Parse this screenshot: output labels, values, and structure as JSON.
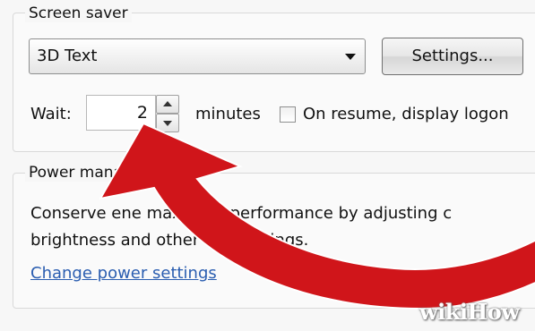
{
  "screen_saver": {
    "legend": "Screen saver",
    "selected_saver": "3D Text",
    "settings_button": "Settings...",
    "wait_label": "Wait:",
    "wait_value": "2",
    "minutes_label": "minutes",
    "on_resume_label": "On resume, display logon",
    "on_resume_checked": false
  },
  "power_management": {
    "legend": "Power manag",
    "description_line1": "Conserve ene        maximize performance by adjusting c",
    "description_line2": "brightness and other    wer settings.",
    "link": "Change power settings"
  },
  "annotation": {
    "arrow_color": "#d0151a"
  },
  "watermark": "wikiHow"
}
